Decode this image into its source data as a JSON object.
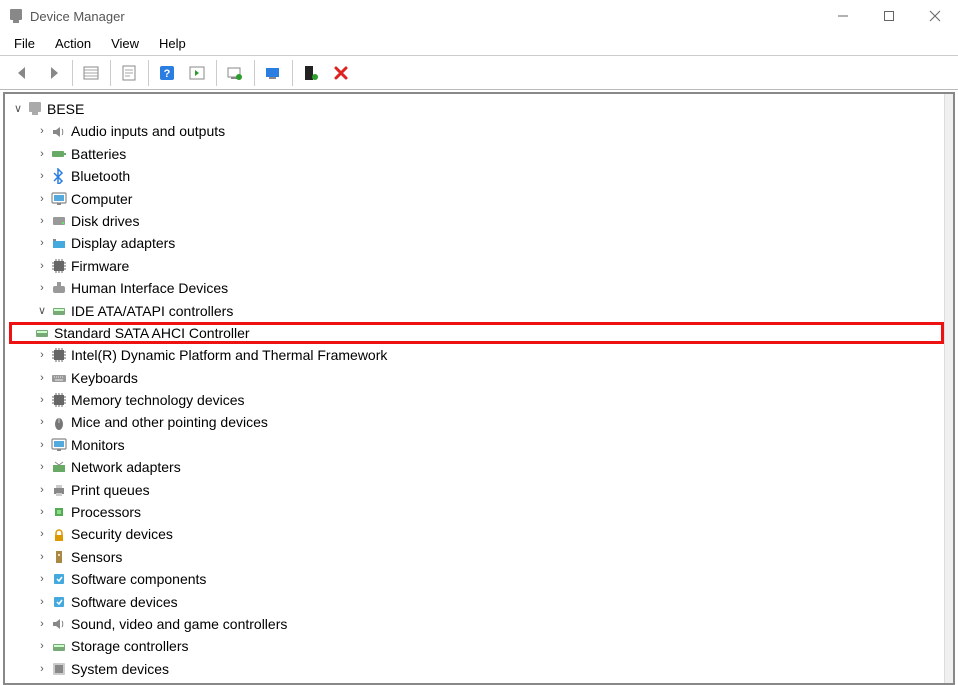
{
  "window": {
    "title": "Device Manager"
  },
  "menu": {
    "file": "File",
    "action": "Action",
    "view": "View",
    "help": "Help"
  },
  "tree": {
    "root": {
      "label": "BESE",
      "expanded": true
    },
    "categories": [
      {
        "id": "audio",
        "label": "Audio inputs and outputs",
        "icon": "speaker-icon",
        "expanded": false
      },
      {
        "id": "batteries",
        "label": "Batteries",
        "icon": "battery-icon",
        "expanded": false
      },
      {
        "id": "bluetooth",
        "label": "Bluetooth",
        "icon": "bluetooth-icon",
        "expanded": false
      },
      {
        "id": "computer",
        "label": "Computer",
        "icon": "monitor-icon",
        "expanded": false
      },
      {
        "id": "disk",
        "label": "Disk drives",
        "icon": "disk-icon",
        "expanded": false
      },
      {
        "id": "display",
        "label": "Display adapters",
        "icon": "gpu-icon",
        "expanded": false
      },
      {
        "id": "firmware",
        "label": "Firmware",
        "icon": "chip-icon",
        "expanded": false
      },
      {
        "id": "hid",
        "label": "Human Interface Devices",
        "icon": "hid-icon",
        "expanded": false
      },
      {
        "id": "ide",
        "label": "IDE ATA/ATAPI controllers",
        "icon": "drive-icon",
        "expanded": true,
        "children": [
          {
            "id": "sata",
            "label": "Standard SATA AHCI Controller",
            "icon": "drive-icon",
            "highlighted": true
          }
        ]
      },
      {
        "id": "intel",
        "label": "Intel(R) Dynamic Platform and Thermal Framework",
        "icon": "chip-icon",
        "expanded": false
      },
      {
        "id": "keyboards",
        "label": "Keyboards",
        "icon": "keyboard-icon",
        "expanded": false
      },
      {
        "id": "memtech",
        "label": "Memory technology devices",
        "icon": "chip-icon",
        "expanded": false
      },
      {
        "id": "mice",
        "label": "Mice and other pointing devices",
        "icon": "mouse-icon",
        "expanded": false
      },
      {
        "id": "monitors",
        "label": "Monitors",
        "icon": "monitor-icon",
        "expanded": false
      },
      {
        "id": "network",
        "label": "Network adapters",
        "icon": "network-icon",
        "expanded": false
      },
      {
        "id": "print",
        "label": "Print queues",
        "icon": "printer-icon",
        "expanded": false
      },
      {
        "id": "cpu",
        "label": "Processors",
        "icon": "cpu-icon",
        "expanded": false
      },
      {
        "id": "security",
        "label": "Security devices",
        "icon": "lock-icon",
        "expanded": false
      },
      {
        "id": "sensors",
        "label": "Sensors",
        "icon": "sensor-icon",
        "expanded": false
      },
      {
        "id": "swcomp",
        "label": "Software components",
        "icon": "sw-icon",
        "expanded": false
      },
      {
        "id": "swdev",
        "label": "Software devices",
        "icon": "sw-icon",
        "expanded": false
      },
      {
        "id": "sound",
        "label": "Sound, video and game controllers",
        "icon": "speaker-icon",
        "expanded": false
      },
      {
        "id": "storage",
        "label": "Storage controllers",
        "icon": "drive-icon",
        "expanded": false
      },
      {
        "id": "system",
        "label": "System devices",
        "icon": "system-icon",
        "expanded": false
      }
    ]
  }
}
